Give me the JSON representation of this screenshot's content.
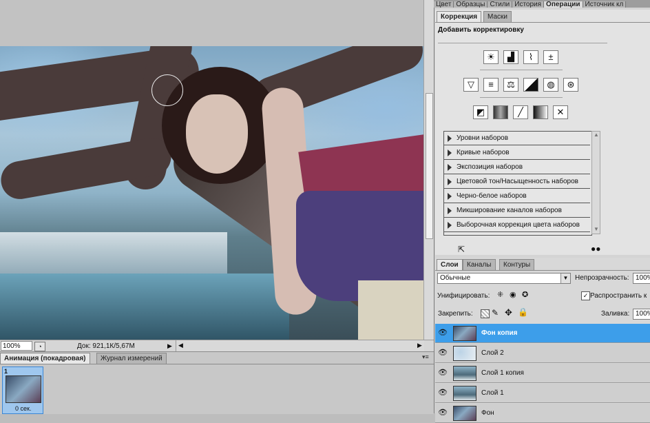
{
  "document": {
    "zoom": "100%",
    "doc_size": "Док: 921,1К/5,67М"
  },
  "bottom_panel": {
    "tabs": [
      {
        "label": "Анимация (покадровая)",
        "active": true
      },
      {
        "label": "Журнал измерений",
        "active": false
      }
    ],
    "frame": {
      "number": "1",
      "delay": "0 сек."
    }
  },
  "panel_tabs_top": [
    "Цвет",
    "Образцы",
    "Стили",
    "История",
    "Операции",
    "Источник кл"
  ],
  "adjustments": {
    "tabs": [
      {
        "label": "Коррекция",
        "active": true
      },
      {
        "label": "Маски",
        "active": false
      }
    ],
    "title": "Добавить корректировку",
    "icon_rows": [
      [
        "brightness-icon",
        "levels-icon",
        "curves-icon",
        "exposure-icon"
      ],
      [
        "vibrance-icon",
        "hue-saturation-icon",
        "color-balance-icon",
        "black-white-icon",
        "photo-filter-icon",
        "channel-mixer-icon"
      ],
      [
        "invert-icon",
        "posterize-icon",
        "threshold-icon",
        "gradient-map-icon",
        "selective-color-icon"
      ]
    ],
    "presets": [
      "Уровни наборов",
      "Кривые наборов",
      "Экспозиция наборов",
      "Цветовой тон/Насыщенность наборов",
      "Черно-белое наборов",
      "Микширование каналов наборов",
      "Выборочная коррекция цвета наборов"
    ]
  },
  "layers": {
    "tabs": [
      {
        "label": "Слои",
        "active": true
      },
      {
        "label": "Каналы",
        "active": false
      },
      {
        "label": "Контуры",
        "active": false
      }
    ],
    "blend_mode": "Обычные",
    "opacity_label": "Непрозрачность:",
    "opacity_value": "100%",
    "unify_label": "Унифицировать:",
    "propagate_label": "Распространить к",
    "propagate_checked": true,
    "lock_label": "Закрепить:",
    "fill_label": "Заливка:",
    "fill_value": "100%",
    "items": [
      {
        "name": "Фон копия",
        "selected": true
      },
      {
        "name": "Слой 2",
        "selected": false
      },
      {
        "name": "Слой 1 копия",
        "selected": false
      },
      {
        "name": "Слой 1",
        "selected": false
      },
      {
        "name": "Фон",
        "selected": false
      }
    ]
  }
}
